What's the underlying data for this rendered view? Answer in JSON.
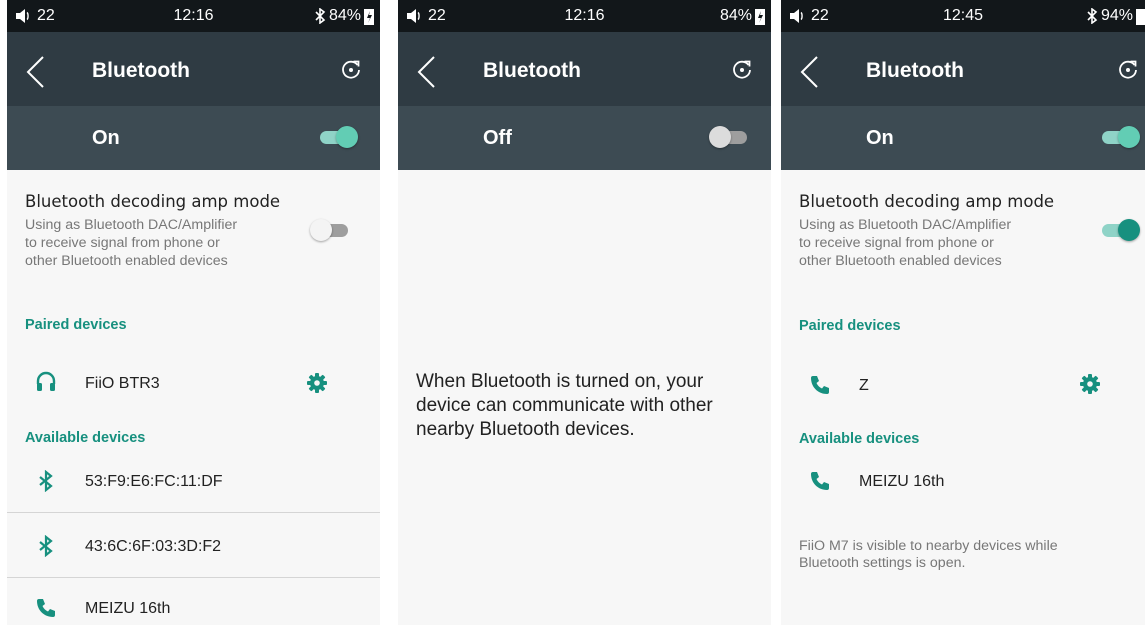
{
  "screens": [
    {
      "status": {
        "volume": "22",
        "time": "12:16",
        "battery": "84%"
      },
      "title": "Bluetooth",
      "toggle_label": "On",
      "amp_mode": {
        "title": "Bluetooth decoding amp mode",
        "desc": [
          "Using as Bluetooth DAC/Amplifier",
          "to receive signal from phone or",
          "other Bluetooth enabled devices"
        ],
        "state": "off"
      },
      "paired_header": "Paired devices",
      "paired": [
        {
          "name": "FiiO BTR3",
          "icon": "headphones-icon"
        }
      ],
      "available_header": "Available devices",
      "available": [
        {
          "name": "53:F9:E6:FC:11:DF",
          "icon": "bluetooth-icon"
        },
        {
          "name": "43:6C:6F:03:3D:F2",
          "icon": "bluetooth-icon"
        },
        {
          "name": "MEIZU 16th",
          "icon": "phone-icon"
        }
      ]
    },
    {
      "status": {
        "volume": "22",
        "time": "12:16",
        "battery": "84%"
      },
      "title": "Bluetooth",
      "toggle_label": "Off",
      "message": [
        "When Bluetooth is turned on, your",
        "device can communicate with other",
        "nearby Bluetooth devices."
      ]
    },
    {
      "status": {
        "volume": "22",
        "time": "12:45",
        "battery": "94%"
      },
      "title": "Bluetooth",
      "toggle_label": "On",
      "amp_mode": {
        "title": "Bluetooth decoding amp mode",
        "desc": [
          "Using as Bluetooth DAC/Amplifier",
          "to receive signal from phone or",
          "other Bluetooth enabled devices"
        ],
        "state": "on"
      },
      "paired_header": "Paired devices",
      "paired": [
        {
          "name": "Z",
          "icon": "phone-icon"
        }
      ],
      "available_header": "Available devices",
      "available": [
        {
          "name": "MEIZU 16th",
          "icon": "phone-icon"
        }
      ],
      "visible_note": [
        "FiiO M7 is visible to nearby devices while",
        "Bluetooth settings is open."
      ]
    }
  ],
  "colors": {
    "accent": "#17907f",
    "switch_on_thumb": "#20a58f",
    "switch_on_track": "#8fd3c7",
    "switch_off_thumb": "#f4f4f4",
    "switch_off_track": "#9e9e9e",
    "titlebar": "#2f3b43",
    "togglebar": "#3d4b53",
    "statusbar": "#12171a"
  }
}
